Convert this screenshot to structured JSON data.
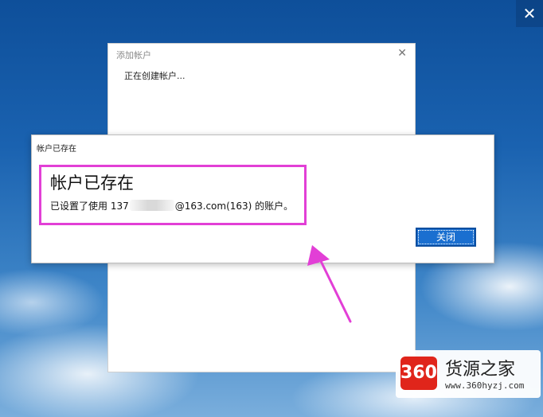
{
  "screen": {
    "close_glyph": "✕"
  },
  "back_dialog": {
    "title": "添加帐户",
    "close_glyph": "✕",
    "status": "正在创建帐户..."
  },
  "front_dialog": {
    "title": "帐户已存在",
    "heading": "帐户已存在",
    "body_prefix": "已设置了使用 137",
    "body_suffix": "@163.com(163) 的账户。",
    "close_button_label": "关闭"
  },
  "annotation": {
    "highlight_color": "#e23fd6",
    "arrow_color": "#e23fd6"
  },
  "watermark": {
    "logo_text": "360",
    "name": "货源之家",
    "url": "www.360hyzj.com"
  },
  "colors": {
    "button_blue": "#1a6fd0",
    "desktop_blue": "#1a62b0"
  }
}
